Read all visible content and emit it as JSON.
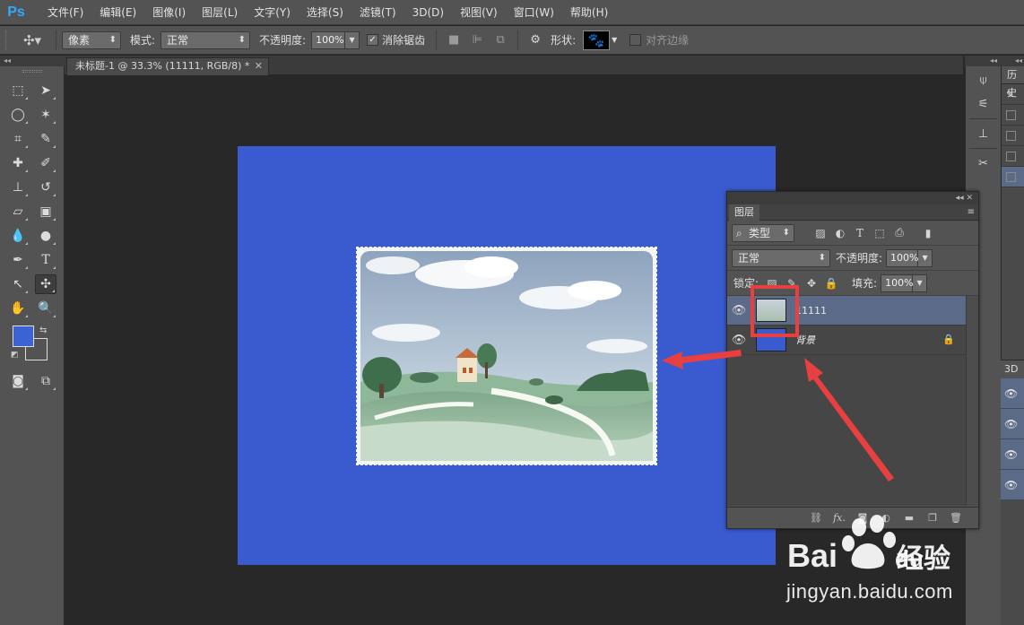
{
  "app": {
    "logo": "Ps"
  },
  "menu": [
    "文件(F)",
    "编辑(E)",
    "图像(I)",
    "图层(L)",
    "文字(Y)",
    "选择(S)",
    "滤镜(T)",
    "3D(D)",
    "视图(V)",
    "窗口(W)",
    "帮助(H)"
  ],
  "options": {
    "fill_type": "像素",
    "mode_label": "模式:",
    "mode_value": "正常",
    "opacity_label": "不透明度:",
    "opacity_value": "100%",
    "antialias_label": "消除锯齿",
    "antialias_checked": true,
    "shape_label": "形状:",
    "align_edges_label": "对齐边缘",
    "align_edges_checked": false
  },
  "document": {
    "tab_title": "未标题-1 @ 33.3% (11111, RGB/8) *",
    "canvas_color": "#3a5bcf"
  },
  "colors": {
    "foreground": "#3b63d4",
    "background": "#535353"
  },
  "layers_panel": {
    "tab": "图层",
    "filter_kind": "类型",
    "blend_mode": "正常",
    "opacity_label": "不透明度:",
    "opacity_value": "100%",
    "lock_label": "锁定:",
    "fill_label": "填充:",
    "fill_value": "100%",
    "layers": [
      {
        "name": "11111",
        "selected": true,
        "visible": true,
        "locked": false
      },
      {
        "name": "背景",
        "selected": false,
        "visible": true,
        "locked": true
      }
    ]
  },
  "right_dock": {
    "history_tab": "历史",
    "panel_3d_tab": "3D"
  },
  "watermark": {
    "brand": "Bai 经验",
    "url": "jingyan.baidu.com"
  },
  "annotation_color": "#e84040"
}
